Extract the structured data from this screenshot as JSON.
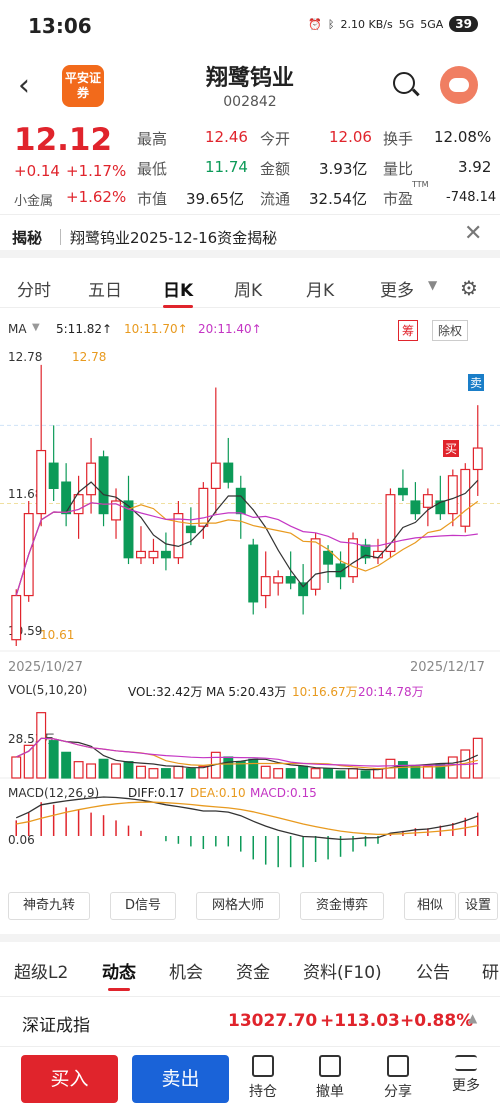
{
  "status": {
    "time": "13:06",
    "net_speed": "2.10 KB/s",
    "sig1": "5G",
    "sig2": "5GA",
    "battery": "39"
  },
  "header": {
    "name": "翔鹭钨业",
    "code": "002842",
    "logo_text": "平安证券"
  },
  "quote": {
    "price": "12.12",
    "change": "+0.14",
    "change_pct": "+1.17%",
    "sector_label": "小金属",
    "sector_pct": "+1.62%",
    "high_label": "最高",
    "high": "12.46",
    "open_label": "今开",
    "open": "12.06",
    "turnover_label": "换手",
    "turnover": "12.08%",
    "low_label": "最低",
    "low": "11.74",
    "amount_label": "金额",
    "amount": "3.93亿",
    "vr_label": "量比",
    "vr": "3.92",
    "mcap_label": "市值",
    "mcap": "39.65亿",
    "float_label": "流通",
    "float": "32.54亿",
    "pe_label": "市盈",
    "pe_sup": "TTM",
    "pe": "-748.14"
  },
  "reveal": {
    "tag": "揭秘",
    "text": "翔鹭钨业2025-12-16资金揭秘"
  },
  "period_tabs": [
    "分时",
    "五日",
    "日K",
    "周K",
    "月K",
    "更多"
  ],
  "active_period": "日K",
  "chart": {
    "ma_label": "MA",
    "ma5": "5:11.82↑",
    "ma10": "10:11.70↑",
    "ma20": "20:11.40↑",
    "chip_btn": "筹",
    "fq_btn": "除权",
    "y_high": "12.78",
    "y_mid": "11.68",
    "y_low": "10.59",
    "max_mark": "12.78",
    "min_mark": "10.61",
    "sell_tag": "卖",
    "buy_tag": "买",
    "date_start": "2025/10/27",
    "date_end": "2025/12/17",
    "vol_label": "VOL(5,10,20)",
    "vol_value": "VOL:32.42万",
    "vol_ma5": "MA 5:20.43万",
    "vol_ma10": "10:16.67万",
    "vol_ma20": "20:14.78万",
    "vol_axis": "28.53万",
    "macd_label": "MACD(12,26,9)",
    "diff": "DIFF:0.17",
    "dea": "DEA:0.10",
    "macd": "MACD:0.15",
    "macd_axis": "0.06"
  },
  "chart_data": {
    "type": "candlestick",
    "ohlc": [
      [
        10.6,
        11.0,
        10.55,
        10.95
      ],
      [
        10.95,
        11.7,
        10.9,
        11.6
      ],
      [
        11.6,
        12.78,
        11.5,
        12.1
      ],
      [
        12.0,
        12.3,
        11.7,
        11.8
      ],
      [
        11.85,
        12.0,
        11.5,
        11.6
      ],
      [
        11.6,
        11.9,
        11.4,
        11.75
      ],
      [
        11.75,
        12.2,
        11.6,
        12.0
      ],
      [
        12.05,
        12.1,
        11.5,
        11.6
      ],
      [
        11.55,
        11.8,
        11.4,
        11.7
      ],
      [
        11.7,
        11.9,
        11.2,
        11.25
      ],
      [
        11.25,
        11.5,
        11.2,
        11.3
      ],
      [
        11.25,
        11.4,
        11.2,
        11.3
      ],
      [
        11.3,
        11.45,
        11.15,
        11.25
      ],
      [
        11.25,
        11.7,
        11.2,
        11.6
      ],
      [
        11.5,
        11.65,
        11.35,
        11.45
      ],
      [
        11.5,
        11.85,
        11.4,
        11.8
      ],
      [
        11.8,
        12.6,
        11.6,
        12.0
      ],
      [
        12.0,
        12.2,
        11.8,
        11.85
      ],
      [
        11.8,
        11.9,
        11.4,
        11.6
      ],
      [
        11.35,
        11.4,
        10.8,
        10.9
      ],
      [
        10.95,
        11.3,
        10.85,
        11.1
      ],
      [
        11.05,
        11.15,
        10.95,
        11.1
      ],
      [
        11.1,
        11.3,
        11.0,
        11.05
      ],
      [
        11.05,
        11.2,
        10.8,
        10.95
      ],
      [
        11.0,
        11.45,
        10.95,
        11.4
      ],
      [
        11.3,
        11.35,
        11.05,
        11.2
      ],
      [
        11.2,
        11.3,
        11.0,
        11.1
      ],
      [
        11.1,
        11.45,
        11.05,
        11.4
      ],
      [
        11.35,
        11.4,
        11.2,
        11.25
      ],
      [
        11.25,
        11.4,
        11.2,
        11.3
      ],
      [
        11.3,
        11.8,
        11.25,
        11.75
      ],
      [
        11.8,
        11.95,
        11.7,
        11.75
      ],
      [
        11.7,
        11.85,
        11.55,
        11.6
      ],
      [
        11.65,
        11.8,
        11.5,
        11.75
      ],
      [
        11.7,
        11.9,
        11.55,
        11.6
      ],
      [
        11.6,
        11.95,
        11.5,
        11.9
      ],
      [
        11.5,
        12.0,
        11.45,
        11.95
      ],
      [
        11.95,
        12.46,
        11.74,
        12.12
      ]
    ],
    "volume": [
      9,
      14,
      28,
      16,
      11,
      7,
      6,
      8,
      6,
      7,
      5,
      4,
      4,
      5,
      4,
      5,
      11,
      9,
      7,
      8,
      5,
      4,
      4,
      5,
      4,
      4,
      3,
      4,
      3,
      4,
      8,
      7,
      5,
      5,
      6,
      9,
      12,
      17
    ],
    "macd_hist": [
      0.06,
      0.09,
      0.13,
      0.12,
      0.11,
      0.1,
      0.09,
      0.08,
      0.06,
      0.04,
      0.02,
      0.0,
      -0.02,
      -0.03,
      -0.04,
      -0.05,
      -0.04,
      -0.04,
      -0.06,
      -0.09,
      -0.11,
      -0.12,
      -0.12,
      -0.12,
      -0.1,
      -0.09,
      -0.08,
      -0.06,
      -0.04,
      -0.03,
      0.01,
      0.02,
      0.03,
      0.03,
      0.04,
      0.05,
      0.07,
      0.09
    ]
  },
  "tools": [
    "神奇九转",
    "D信号",
    "网格大师",
    "资金博弈",
    "相似",
    "设置"
  ],
  "lower_tabs": [
    "超级L2",
    "动态",
    "机会",
    "资金",
    "资料(F10)",
    "公告",
    "研"
  ],
  "active_lower_tab": "动态",
  "index": {
    "name": "深证成指",
    "value": "13027.70",
    "change": "+113.03",
    "pct": "+0.88%"
  },
  "bottom": {
    "buy": "买入",
    "sell": "卖出",
    "hold": "持仓",
    "cancel": "撤单",
    "share": "分享",
    "more": "更多",
    "buy_color": "#e0242c",
    "sell_color": "#1a63d8"
  }
}
